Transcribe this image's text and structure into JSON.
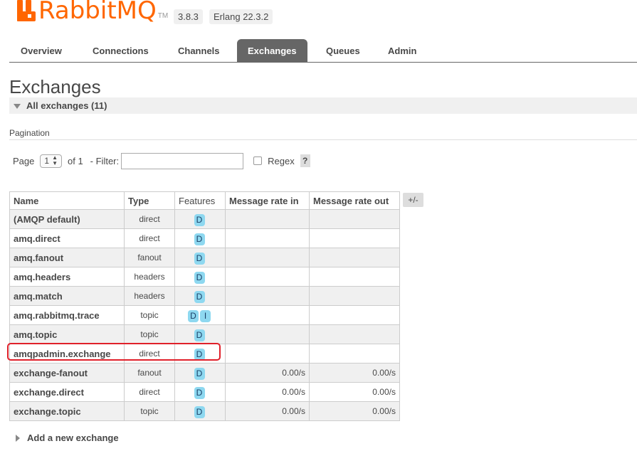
{
  "header": {
    "logo_text": "RabbitMQ",
    "logo_tm": "TM",
    "version": "3.8.3",
    "erlang": "Erlang 22.3.2"
  },
  "tabs": [
    {
      "label": "Overview",
      "active": false
    },
    {
      "label": "Connections",
      "active": false
    },
    {
      "label": "Channels",
      "active": false
    },
    {
      "label": "Exchanges",
      "active": true
    },
    {
      "label": "Queues",
      "active": false
    },
    {
      "label": "Admin",
      "active": false
    }
  ],
  "page_title": "Exchanges",
  "section_title": "All exchanges (11)",
  "pagination": {
    "label": "Pagination",
    "page_label": "Page",
    "page_value": "1",
    "of_label": "of 1",
    "filter_label": "- Filter:",
    "filter_value": "",
    "regex_label": "Regex",
    "help_label": "?"
  },
  "table": {
    "headers": [
      "Name",
      "Type",
      "Features",
      "Message rate in",
      "Message rate out"
    ],
    "columns_toggle": "+/-",
    "rows": [
      {
        "name": "(AMQP default)",
        "type": "direct",
        "features": [
          "D"
        ],
        "rate_in": "",
        "rate_out": ""
      },
      {
        "name": "amq.direct",
        "type": "direct",
        "features": [
          "D"
        ],
        "rate_in": "",
        "rate_out": ""
      },
      {
        "name": "amq.fanout",
        "type": "fanout",
        "features": [
          "D"
        ],
        "rate_in": "",
        "rate_out": ""
      },
      {
        "name": "amq.headers",
        "type": "headers",
        "features": [
          "D"
        ],
        "rate_in": "",
        "rate_out": ""
      },
      {
        "name": "amq.match",
        "type": "headers",
        "features": [
          "D"
        ],
        "rate_in": "",
        "rate_out": ""
      },
      {
        "name": "amq.rabbitmq.trace",
        "type": "topic",
        "features": [
          "D",
          "I"
        ],
        "rate_in": "",
        "rate_out": ""
      },
      {
        "name": "amq.topic",
        "type": "topic",
        "features": [
          "D"
        ],
        "rate_in": "",
        "rate_out": ""
      },
      {
        "name": "amqpadmin.exchange",
        "type": "direct",
        "features": [
          "D"
        ],
        "rate_in": "",
        "rate_out": ""
      },
      {
        "name": "exchange-fanout",
        "type": "fanout",
        "features": [
          "D"
        ],
        "rate_in": "0.00/s",
        "rate_out": "0.00/s"
      },
      {
        "name": "exchange.direct",
        "type": "direct",
        "features": [
          "D"
        ],
        "rate_in": "0.00/s",
        "rate_out": "0.00/s"
      },
      {
        "name": "exchange.topic",
        "type": "topic",
        "features": [
          "D"
        ],
        "rate_in": "0.00/s",
        "rate_out": "0.00/s"
      }
    ]
  },
  "add_new_label": "Add a new exchange",
  "colors": {
    "accent": "#ff6600",
    "active_tab": "#666666",
    "badge": "#8ed8f0",
    "highlight": "#e0202a"
  }
}
